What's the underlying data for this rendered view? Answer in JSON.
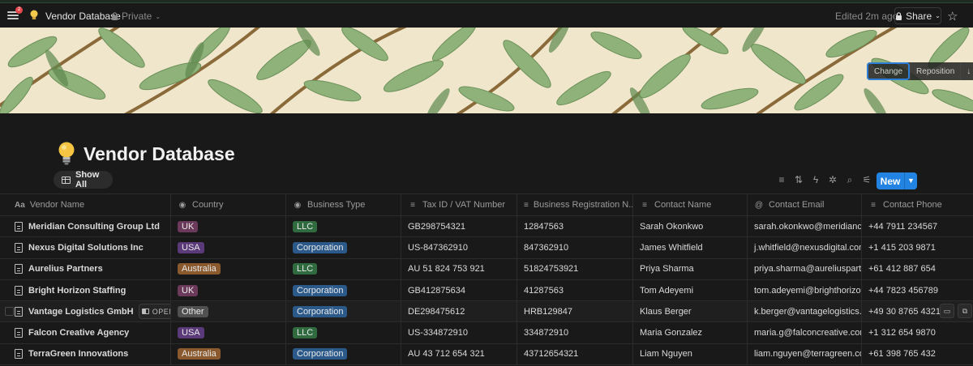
{
  "topbar": {
    "notification_count": "2",
    "page_title": "Vendor Database",
    "privacy": "Private",
    "edited": "Edited 2m ago",
    "share_label": "Share"
  },
  "cover": {
    "change_label": "Change",
    "reposition_label": "Reposition"
  },
  "page": {
    "title": "Vendor Database",
    "icon": "lightbulb-icon"
  },
  "view": {
    "tab_label": "Show All",
    "new_label": "New"
  },
  "colors": {
    "accent": "#2383e2",
    "background": "#191919",
    "tag_uk": "#6b3a5a",
    "tag_usa": "#5a3a78",
    "tag_australia": "#8a5a2e",
    "tag_other": "#505050",
    "tag_llc": "#2f6b3f",
    "tag_corporation": "#2b5a8a"
  },
  "table": {
    "columns": [
      {
        "label": "Vendor Name",
        "icon": "Aa"
      },
      {
        "label": "Country",
        "icon": "select-icon"
      },
      {
        "label": "Business Type",
        "icon": "select-icon"
      },
      {
        "label": "Tax ID / VAT Number",
        "icon": "text-icon"
      },
      {
        "label": "Business Registration N...",
        "icon": "text-icon"
      },
      {
        "label": "Contact Name",
        "icon": "text-icon"
      },
      {
        "label": "Contact Email",
        "icon": "at-icon"
      },
      {
        "label": "Contact Phone",
        "icon": "text-icon"
      }
    ],
    "open_label": "OPEN",
    "rows": [
      {
        "name": "Meridian Consulting Group Ltd",
        "country": "UK",
        "type": "LLC",
        "tax": "GB298754321",
        "reg": "12847563",
        "contact": "Sarah Okonkwo",
        "email": "sarah.okonkwo@meridiancg.co",
        "phone": "+44 7911 234567"
      },
      {
        "name": "Nexus Digital Solutions Inc",
        "country": "USA",
        "type": "Corporation",
        "tax": "US-847362910",
        "reg": "847362910",
        "contact": "James Whitfield",
        "email": "j.whitfield@nexusdigital.com",
        "phone": "+1 415 203 9871"
      },
      {
        "name": "Aurelius Partners",
        "country": "Australia",
        "type": "LLC",
        "tax": "AU 51 824 753 921",
        "reg": "51824753921",
        "contact": "Priya Sharma",
        "email": "priya.sharma@aureliuspartners",
        "phone": "+61 412 887 654"
      },
      {
        "name": "Bright Horizon Staffing",
        "country": "UK",
        "type": "Corporation",
        "tax": "GB412875634",
        "reg": "41287563",
        "contact": "Tom Adeyemi",
        "email": "tom.adeyemi@brighthorizon.co",
        "phone": "+44 7823 456789"
      },
      {
        "name": "Vantage Logistics GmbH",
        "country": "Other",
        "type": "Corporation",
        "tax": "DE298475612",
        "reg": "HRB129847",
        "contact": "Klaus Berger",
        "email": "k.berger@vantagelogistics.de",
        "phone": "+49 30 8765 4321"
      },
      {
        "name": "Falcon Creative Agency",
        "country": "USA",
        "type": "LLC",
        "tax": "US-334872910",
        "reg": "334872910",
        "contact": "Maria Gonzalez",
        "email": "maria.g@falconcreative.com",
        "phone": "+1 312 654 9870"
      },
      {
        "name": "TerraGreen Innovations",
        "country": "Australia",
        "type": "Corporation",
        "tax": "AU 43 712 654 321",
        "reg": "43712654321",
        "contact": "Liam Nguyen",
        "email": "liam.nguyen@terragreen.com.a",
        "phone": "+61 398 765 432"
      }
    ]
  }
}
